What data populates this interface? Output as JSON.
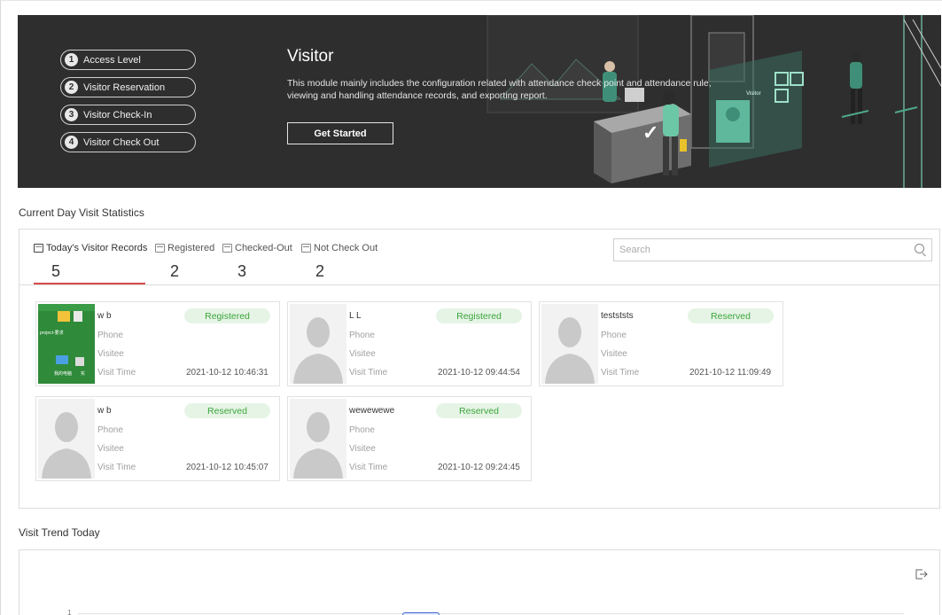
{
  "banner": {
    "steps": [
      {
        "num": "1",
        "label": "Access Level"
      },
      {
        "num": "2",
        "label": "Visitor Reservation"
      },
      {
        "num": "3",
        "label": "Visitor Check-In"
      },
      {
        "num": "4",
        "label": "Visitor Check Out"
      }
    ],
    "title": "Visitor",
    "description": "This module mainly includes the configuration related with attendance check point and attendance rule, viewing and handling attendance records, and exporting report.",
    "cta_label": "Get Started",
    "illustration": {
      "screen_label": "Visitor",
      "check_mark": "✓"
    }
  },
  "stats": {
    "title": "Current Day Visit Statistics",
    "tabs": [
      {
        "label": "Today's Visitor Records",
        "count": "5",
        "active": true
      },
      {
        "label": "Registered",
        "count": "2"
      },
      {
        "label": "Checked-Out",
        "count": "3"
      },
      {
        "label": "Not Check Out",
        "count": "2"
      }
    ],
    "search_placeholder": "Search",
    "field_labels": {
      "phone": "Phone",
      "visitee": "Visitee",
      "visit_time": "Visit Time"
    },
    "cards": [
      {
        "name": "w b",
        "status": "Registered",
        "visit_time": "2021-10-12 10:46:31",
        "photo": "desktop-screenshot",
        "photo_labels": [
          "project-要求",
          "我的电脑",
          "实"
        ]
      },
      {
        "name": "L L",
        "status": "Registered",
        "visit_time": "2021-10-12 09:44:54",
        "photo": "silhouette"
      },
      {
        "name": "testststs",
        "status": "Reserved",
        "visit_time": "2021-10-12 11:09:49",
        "photo": "silhouette"
      },
      {
        "name": "w b",
        "status": "Reserved",
        "visit_time": "2021-10-12 10:45:07",
        "photo": "silhouette"
      },
      {
        "name": "wewewewe",
        "status": "Reserved",
        "visit_time": "2021-10-12 09:24:45",
        "photo": "silhouette"
      }
    ]
  },
  "trend": {
    "title": "Visit Trend Today",
    "export_icon": "export-icon",
    "y_tick": "1"
  },
  "colors": {
    "banner_bg": "#2e2e2e",
    "accent_underline": "#d94a4a",
    "badge_bg": "#e6f4e6",
    "badge_text": "#3aa63a",
    "illustration_teal": "#3f8f78"
  }
}
